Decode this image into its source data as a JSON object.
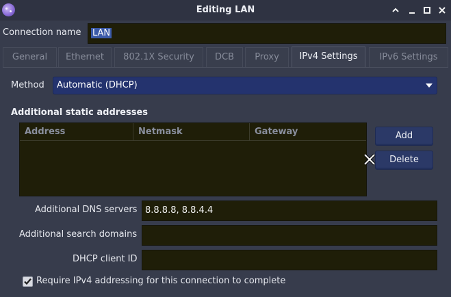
{
  "window": {
    "title": "Editing LAN"
  },
  "connection": {
    "name_label": "Connection name",
    "name_value": "LAN"
  },
  "tabs": [
    {
      "label": "General"
    },
    {
      "label": "Ethernet"
    },
    {
      "label": "802.1X Security"
    },
    {
      "label": "DCB"
    },
    {
      "label": "Proxy"
    },
    {
      "label": "IPv4 Settings",
      "active": true
    },
    {
      "label": "IPv6 Settings"
    }
  ],
  "ipv4": {
    "method_label": "Method",
    "method_value": "Automatic (DHCP)",
    "static_section_title": "Additional static addresses",
    "columns": [
      "Address",
      "Netmask",
      "Gateway"
    ],
    "rows": [],
    "add_label": "Add",
    "delete_label": "Delete",
    "dns_label": "Additional DNS servers",
    "dns_value": "8.8.8.8, 8.8.4.4",
    "search_domains_label": "Additional search domains",
    "search_domains_value": "",
    "dhcp_client_id_label": "DHCP client ID",
    "dhcp_client_id_value": "",
    "require_ipv4_label": "Require IPv4 addressing for this connection to complete",
    "require_ipv4_checked": true
  },
  "colors": {
    "window_bg": "#373c4c",
    "field_bg": "#1f1e08",
    "combo_bg": "#24336e",
    "selection": "#3b5aa8"
  }
}
